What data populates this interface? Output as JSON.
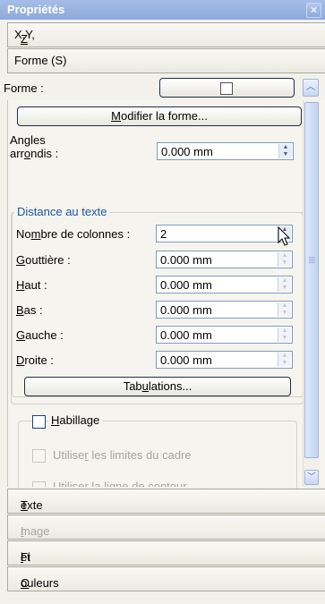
{
  "window": {
    "title": "Propriétés",
    "close_glyph": "×"
  },
  "sections_top": [
    {
      "label": "X,Y,Z",
      "mnemonic": "Z"
    },
    {
      "label": "Forme (S)",
      "mnemonic": "S"
    }
  ],
  "forme": {
    "label": "Forme :",
    "shape_button_icon": "square-shape-icon",
    "modify_button": {
      "before": "",
      "mnemonic": "M",
      "after": "odifier la forme..."
    }
  },
  "angles": {
    "label_line1": "Angles",
    "label_line2_before": "arr",
    "mnemonic": "o",
    "label_line2_after": "ndis :",
    "value": "0.000 mm"
  },
  "distance_group": {
    "title": "Distance au texte",
    "columns": {
      "before": "No",
      "mnemonic": "m",
      "after": "bre de colonnes :",
      "value": "2"
    },
    "gutter": {
      "before": "",
      "mnemonic": "G",
      "after": "outtière :",
      "value": "0.000 mm"
    },
    "top": {
      "before": "",
      "mnemonic": "H",
      "after": "aut :",
      "value": "0.000 mm"
    },
    "bottom": {
      "before": "",
      "mnemonic": "B",
      "after": "as :",
      "value": "0.000 mm"
    },
    "left": {
      "before": "",
      "mnemonic": "G",
      "after": "auche :",
      "value": "0.000 mm"
    },
    "right": {
      "before": "",
      "mnemonic": "D",
      "after": "roite :",
      "value": "0.000 mm"
    },
    "tabs_button": {
      "before": "Tab",
      "mnemonic": "u",
      "after": "lations..."
    }
  },
  "wrap_group": {
    "title_before": "",
    "title_mnemonic": "H",
    "title_after": "abillage",
    "checked": false,
    "opt1": {
      "before": "Utilise",
      "mnemonic": "r",
      "after": " les limites du cadre",
      "checked": false,
      "enabled": false
    },
    "opt2": {
      "text": "Utiliser la ligne de contour",
      "checked": false,
      "enabled": false
    }
  },
  "sections_bottom": [
    {
      "before": "",
      "mnemonic": "T",
      "after": "exte",
      "enabled": true
    },
    {
      "before": "",
      "mnemonic": "I",
      "after": "mage",
      "enabled": false
    },
    {
      "before": "Fi",
      "mnemonic": "l",
      "after": "et",
      "enabled": true
    },
    {
      "before": "",
      "mnemonic": "C",
      "after": "ouleurs",
      "enabled": true
    }
  ],
  "spin_glyphs": {
    "up": "▲",
    "down": "▼"
  },
  "scroll_glyphs": {
    "up": "︿",
    "down": "﹀"
  }
}
